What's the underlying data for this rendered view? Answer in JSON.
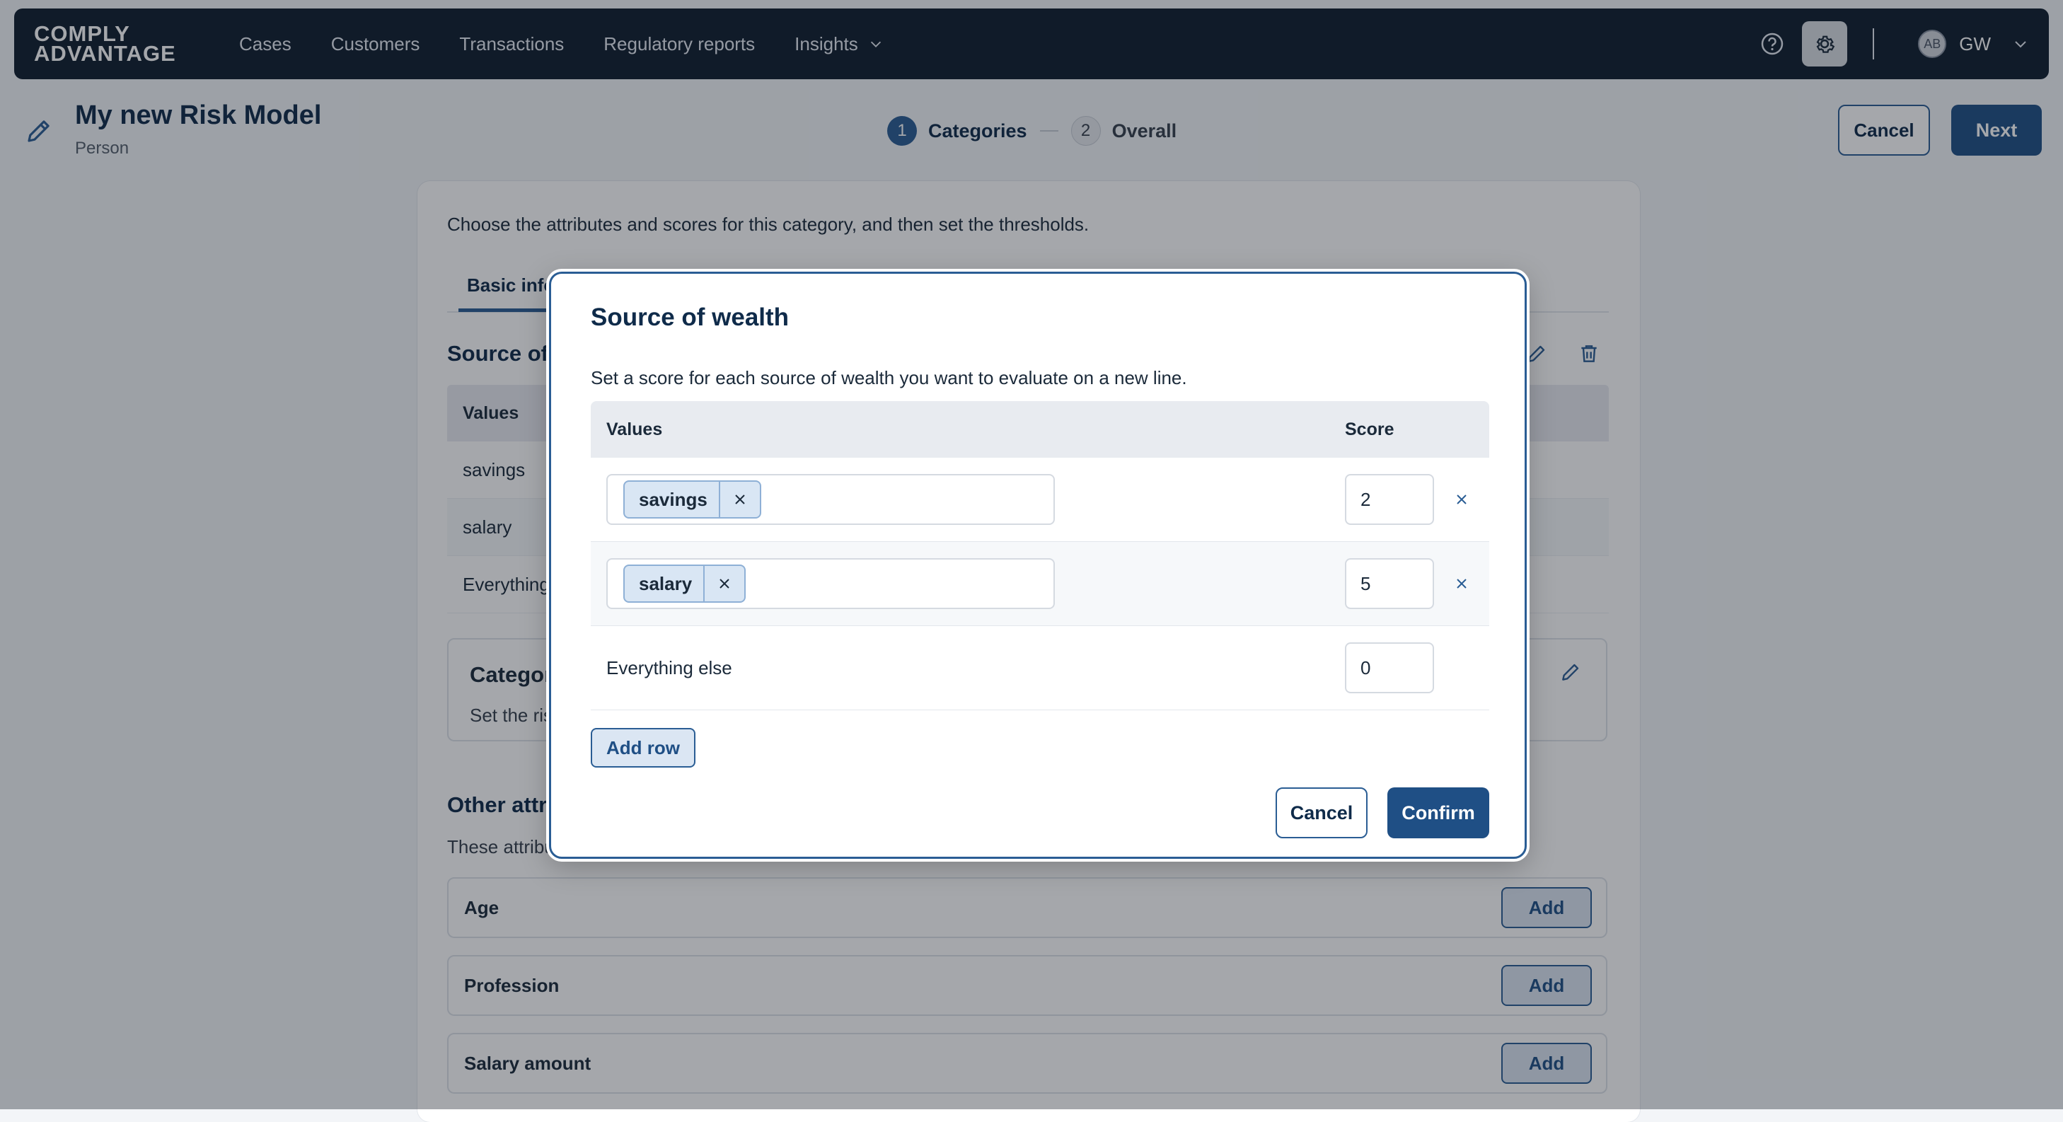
{
  "nav": {
    "logo_line1": "COMPLY",
    "logo_line2": "ADVANTAGE",
    "links": [
      "Cases",
      "Customers",
      "Transactions",
      "Regulatory reports",
      "Insights"
    ],
    "avatar_initials": "AB",
    "user_initials": "GW"
  },
  "header": {
    "title": "My new Risk Model",
    "subtitle": "Person",
    "steps": [
      {
        "num": "1",
        "label": "Categories"
      },
      {
        "num": "2",
        "label": "Overall"
      }
    ],
    "cancel_label": "Cancel",
    "next_label": "Next"
  },
  "page": {
    "instruction": "Choose the attributes and scores for this category, and then set the thresholds.",
    "tab_label": "Basic info",
    "section_title": "Source of wealth",
    "table_header": "Values",
    "rows": [
      "savings",
      "salary",
      "Everything else"
    ],
    "category_title": "Category thresholds",
    "category_sub": "Set the risk",
    "other_title": "Other attributes",
    "other_sub": "These attributes",
    "attributes": [
      "Age",
      "Profession",
      "Salary amount"
    ],
    "add_label": "Add"
  },
  "modal": {
    "title": "Source of wealth",
    "description": "Set a score for each source of wealth you want to evaluate on a new line.",
    "col_values": "Values",
    "col_score": "Score",
    "rows": [
      {
        "chip": "savings",
        "score": "2"
      },
      {
        "chip": "salary",
        "score": "5"
      }
    ],
    "else_label": "Everything else",
    "else_score": "0",
    "add_row_label": "Add row",
    "cancel_label": "Cancel",
    "confirm_label": "Confirm"
  },
  "colors": {
    "nav_bg": "#0f1d2e",
    "primary": "#1f4f85",
    "accent": "#2a5d94",
    "chip_bg": "#d9e6f4"
  }
}
